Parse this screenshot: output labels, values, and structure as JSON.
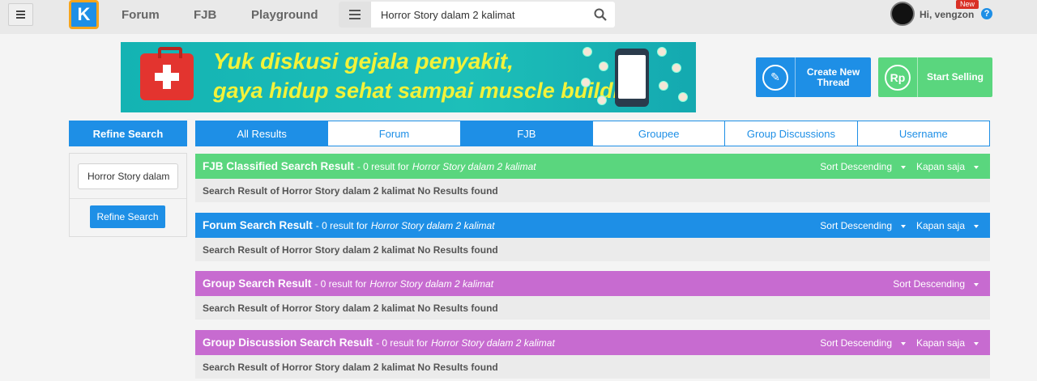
{
  "nav": {
    "logo_letter": "K",
    "links": [
      "Forum",
      "FJB",
      "Playground"
    ],
    "search_value": "Horror Story dalam 2 kalimat",
    "user_greeting": "Hi, vengzon",
    "new_badge": "New",
    "help_symbol": "?"
  },
  "banner": {
    "line1": "Yuk diskusi gejala penyakit,",
    "line2": "gaya hidup sehat sampai muscle building"
  },
  "actions": {
    "create_thread": "Create New Thread",
    "start_selling": "Start Selling",
    "rp_symbol": "Rp",
    "pencil_symbol": "✎"
  },
  "sidebar": {
    "header": "Refine Search",
    "input_value": "Horror Story dalam",
    "button": "Refine Search"
  },
  "tabs": [
    "All Results",
    "Forum",
    "FJB",
    "Groupee",
    "Group Discussions",
    "Username"
  ],
  "results": [
    {
      "title": "FJB Classified Search Result",
      "count": "- 0 result for",
      "query": "Horror Story dalam 2 kalimat",
      "sort": "Sort Descending",
      "time": "Kapan saja",
      "body": "Search Result of Horror Story dalam 2 kalimat No Results found",
      "color": "#5ad67e"
    },
    {
      "title": "Forum Search Result",
      "count": "- 0 result for",
      "query": "Horror Story dalam 2 kalimat",
      "sort": "Sort Descending",
      "time": "Kapan saja",
      "body": "Search Result of Horror Story dalam 2 kalimat No Results found",
      "color": "#1e8fe6"
    },
    {
      "title": "Group Search Result",
      "count": "- 0 result for",
      "query": "Horror Story dalam 2 kalimat",
      "sort": "Sort Descending",
      "time": "",
      "body": "Search Result of Horror Story dalam 2 kalimat No Results found",
      "color": "#c76bd0"
    },
    {
      "title": "Group Discussion Search Result",
      "count": "- 0 result for",
      "query": "Horror Story dalam 2 kalimat",
      "sort": "Sort Descending",
      "time": "Kapan saja",
      "body": "Search Result of Horror Story dalam 2 kalimat No Results found",
      "color": "#c76bd0"
    }
  ],
  "colors": {
    "accent_blue": "#1e8fe6",
    "green": "#5ad67e",
    "purple": "#c76bd0",
    "logo_border": "#f7a51c"
  }
}
